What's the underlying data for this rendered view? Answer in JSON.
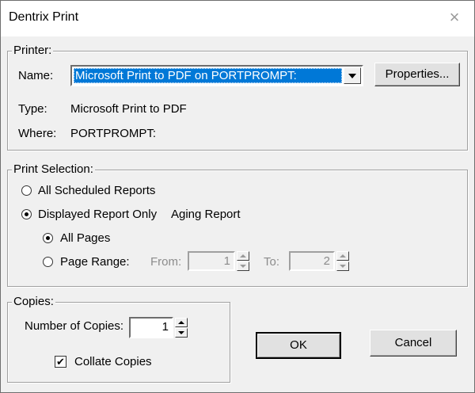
{
  "window": {
    "title": "Dentrix Print",
    "close_icon": "×"
  },
  "printer": {
    "legend": "Printer:",
    "name_label": "Name:",
    "name_value": "Microsoft Print to PDF on PORTPROMPT:",
    "properties_label": "Properties...",
    "type_label": "Type:",
    "type_value": "Microsoft Print to PDF",
    "where_label": "Where:",
    "where_value": "PORTPROMPT:"
  },
  "print_selection": {
    "legend": "Print Selection:",
    "all_scheduled_label": "All Scheduled Reports",
    "all_scheduled_checked": false,
    "displayed_only_label": "Displayed Report Only",
    "displayed_only_checked": true,
    "report_name": "Aging Report",
    "all_pages_label": "All Pages",
    "all_pages_checked": true,
    "page_range_label": "Page Range:",
    "page_range_checked": false,
    "from_label": "From:",
    "from_value": "1",
    "to_label": "To:",
    "to_value": "2"
  },
  "copies": {
    "legend": "Copies:",
    "number_label": "Number of Copies:",
    "number_value": "1",
    "collate_label": "Collate Copies",
    "collate_checked": true,
    "collate_mark": "✔"
  },
  "buttons": {
    "ok": "OK",
    "cancel": "Cancel"
  }
}
